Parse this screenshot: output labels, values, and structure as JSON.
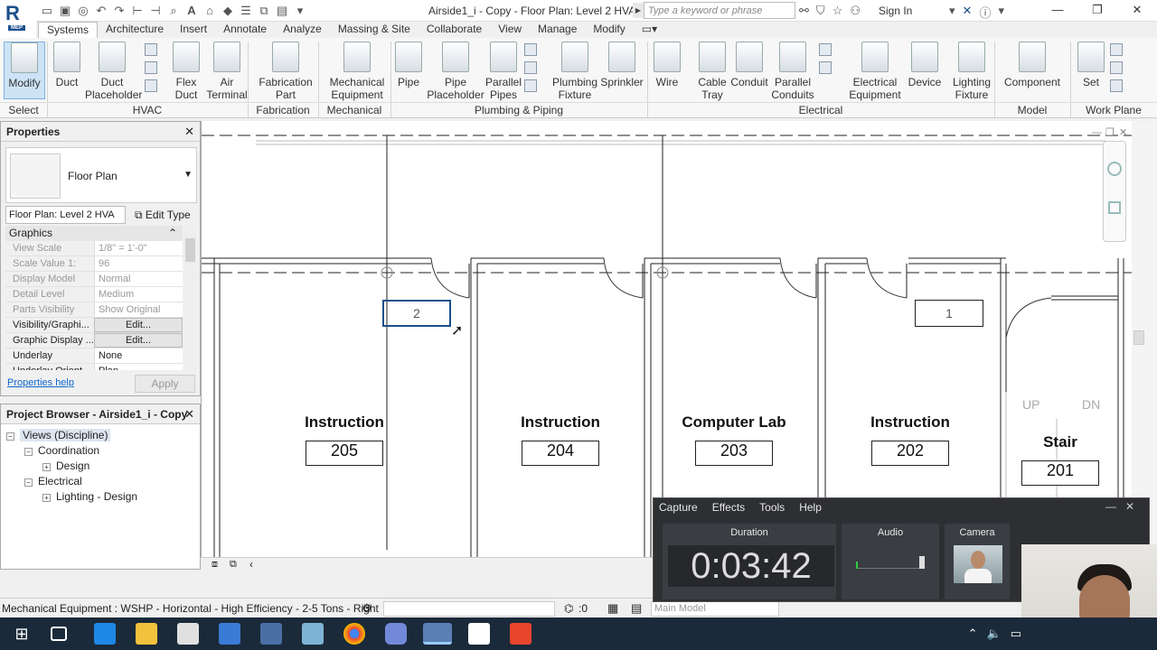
{
  "titlebar": {
    "title": "Airside1_i - Copy - Floor Plan: Level 2 HVAC...",
    "search_placeholder": "Type a keyword or phrase",
    "sign_in": "Sign In",
    "logo_badge": "MEP"
  },
  "tabs": [
    "Systems",
    "Architecture",
    "Insert",
    "Annotate",
    "Analyze",
    "Massing & Site",
    "Collaborate",
    "View",
    "Manage",
    "Modify"
  ],
  "active_tab": "Systems",
  "ribbon": {
    "buttons": [
      {
        "label": "Modify",
        "name": "modify-button"
      },
      {
        "label": "Duct",
        "name": "duct-button"
      },
      {
        "label": "Duct\nPlaceholder",
        "name": "duct-placeholder-button"
      },
      {
        "label": "Flex\nDuct",
        "name": "flex-duct-button"
      },
      {
        "label": "Air\nTerminal",
        "name": "air-terminal-button"
      },
      {
        "label": "Fabrication\nPart",
        "name": "fabrication-part-button"
      },
      {
        "label": "Mechanical\nEquipment",
        "name": "mechanical-equipment-button"
      },
      {
        "label": "Pipe",
        "name": "pipe-button"
      },
      {
        "label": "Pipe\nPlaceholder",
        "name": "pipe-placeholder-button"
      },
      {
        "label": "Parallel\nPipes",
        "name": "parallel-pipes-button"
      },
      {
        "label": "Plumbing\nFixture",
        "name": "plumbing-fixture-button"
      },
      {
        "label": "Sprinkler",
        "name": "sprinkler-button"
      },
      {
        "label": "Wire",
        "name": "wire-button"
      },
      {
        "label": "Cable\nTray",
        "name": "cable-tray-button"
      },
      {
        "label": "Conduit",
        "name": "conduit-button"
      },
      {
        "label": "Parallel\nConduits",
        "name": "parallel-conduits-button"
      },
      {
        "label": "Electrical\nEquipment",
        "name": "electrical-equipment-button"
      },
      {
        "label": "Device",
        "name": "device-button"
      },
      {
        "label": "Lighting\nFixture",
        "name": "lighting-fixture-button"
      },
      {
        "label": "Component",
        "name": "component-button"
      },
      {
        "label": "Set",
        "name": "set-button"
      }
    ],
    "panels": [
      "Select",
      "HVAC",
      "Fabrication",
      "Mechanical",
      "Plumbing & Piping",
      "Electrical",
      "Model",
      "Work Plane"
    ]
  },
  "properties": {
    "title": "Properties",
    "type_name": "Floor Plan",
    "instance": "Floor Plan: Level 2 HVA",
    "edit_type": "Edit Type",
    "group": "Graphics",
    "rows": [
      {
        "k": "View Scale",
        "v": "1/8\" = 1'-0\""
      },
      {
        "k": "Scale Value    1:",
        "v": "96"
      },
      {
        "k": "Display Model",
        "v": "Normal"
      },
      {
        "k": "Detail Level",
        "v": "Medium"
      },
      {
        "k": "Parts Visibility",
        "v": "Show Original"
      },
      {
        "k": "Visibility/Graphi...",
        "v": "Edit..."
      },
      {
        "k": "Graphic Display ...",
        "v": "Edit..."
      },
      {
        "k": "Underlay",
        "v": "None"
      },
      {
        "k": "Underlay Orient...",
        "v": "Plan"
      }
    ],
    "help": "Properties help",
    "apply": "Apply"
  },
  "browser": {
    "title": "Project Browser - Airside1_i - Copy",
    "tree": [
      {
        "label": "Views (Discipline)",
        "depth": 0,
        "toggle": "−"
      },
      {
        "label": "Coordination",
        "depth": 1,
        "toggle": "−"
      },
      {
        "label": "Design",
        "depth": 2,
        "toggle": "+"
      },
      {
        "label": "Electrical",
        "depth": 1,
        "toggle": "−"
      },
      {
        "label": "Lighting - Design",
        "depth": 2,
        "toggle": "+"
      }
    ]
  },
  "rooms": [
    {
      "name": "Instruction",
      "number": "205"
    },
    {
      "name": "Instruction",
      "number": "204"
    },
    {
      "name": "Computer Lab",
      "number": "203"
    },
    {
      "name": "Instruction",
      "number": "202"
    },
    {
      "name": "Stair",
      "number": "201"
    }
  ],
  "tags": [
    "2",
    "1"
  ],
  "stair_labels": [
    "UP",
    "DN"
  ],
  "status": {
    "text": "Mechanical Equipment : WSHP - Horizontal - High Efficiency - 2-5 Tons - Right",
    "selection_count": ":0",
    "model": "Main Model"
  },
  "recorder": {
    "menu": [
      "Capture",
      "Effects",
      "Tools",
      "Help"
    ],
    "duration_label": "Duration",
    "duration": "0:03:42",
    "audio_label": "Audio",
    "camera_label": "Camera"
  }
}
